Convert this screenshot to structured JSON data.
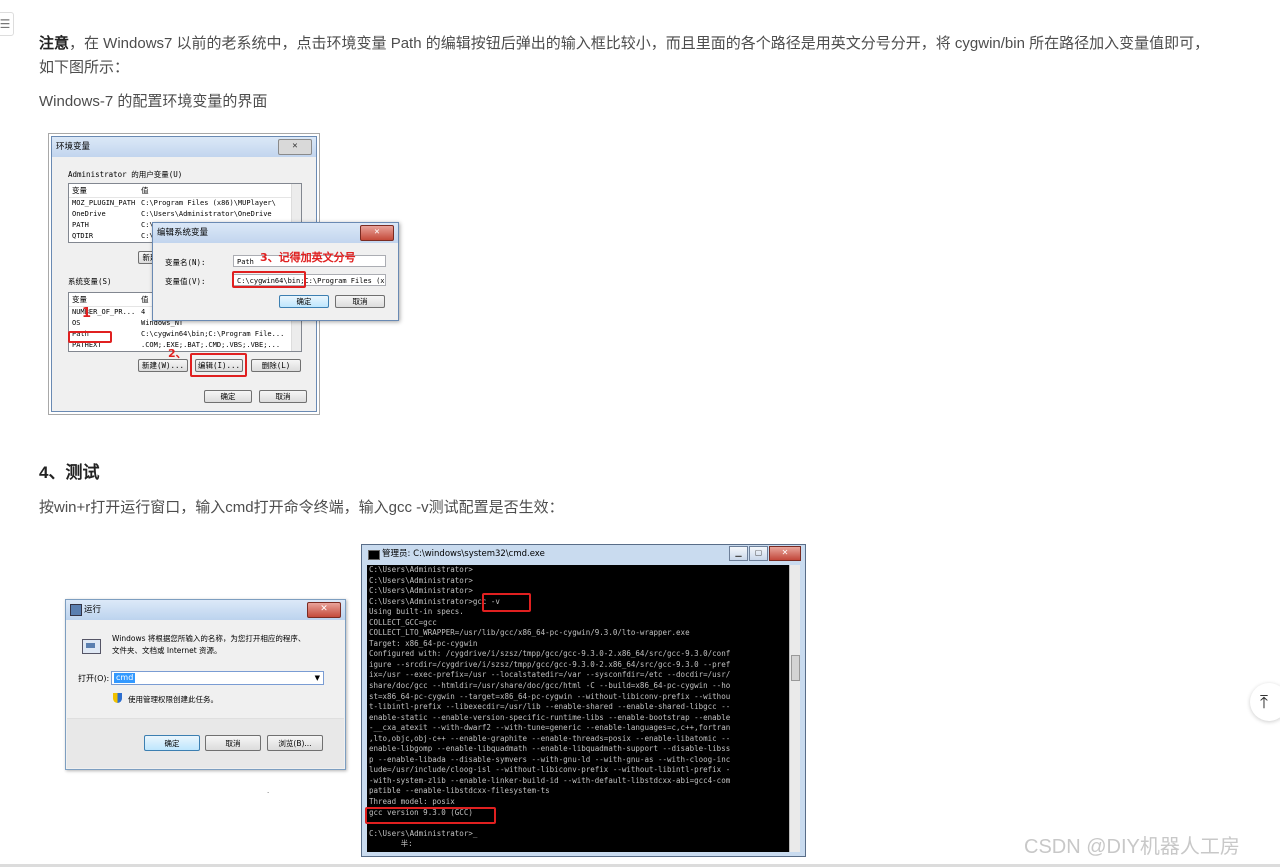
{
  "note": {
    "bold": "注意",
    "text_line1": "，在 Windows7 以前的老系统中，点击环境变量 Path 的编辑按钮后弹出的输入框比较小，而且里面的各个路径是用英文分号分开，将 cygwin/bin 所在路径加入变量值即可，",
    "text_line2": "如下图所示："
  },
  "caption1": "Windows-7 的配置环境变量的界面",
  "env_dialog": {
    "title": "环境变量",
    "user_group": "Administrator 的用户变量(U)",
    "col_var": "变量",
    "col_val": "值",
    "user_rows": [
      {
        "var": "MOZ_PLUGIN_PATH",
        "val": "C:\\Program Files (x86)\\MUPlayer\\"
      },
      {
        "var": "OneDrive",
        "val": "C:\\Users\\Administrator\\OneDrive"
      },
      {
        "var": "PATH",
        "val": "C:\\"
      },
      {
        "var": "QTDIR",
        "val": "C:\\"
      }
    ],
    "user_new_btn": "新建",
    "sys_group": "系统变量(S)",
    "sys_rows": [
      {
        "var": "NUMBER_OF_PR...",
        "val": "4"
      },
      {
        "var": "OS",
        "val": "Windows_NT"
      },
      {
        "var": "Path",
        "val": "C:\\cygwin64\\bin;C:\\Program File..."
      },
      {
        "var": "PATHEXT",
        "val": ".COM;.EXE;.BAT;.CMD;.VBS;.VBE;..."
      }
    ],
    "btn_new": "新建(W)...",
    "btn_edit": "编辑(I)...",
    "btn_delete": "删除(L)",
    "btn_ok": "确定",
    "btn_cancel": "取消",
    "mark1": "1",
    "mark2": "2、"
  },
  "edit_dialog": {
    "title": "编辑系统变量",
    "name_label": "变量名(N):",
    "name_value": "Path",
    "value_label": "变量值(V):",
    "value_value": "C:\\cygwin64\\bin;C:\\Program Files (x86",
    "btn_ok": "确定",
    "btn_cancel": "取消",
    "mark3": "3、记得加英文分号"
  },
  "section": {
    "title": "4、测试",
    "text": "按win+r打开运行窗口，输入cmd打开命令终端，输入gcc -v测试配置是否生效："
  },
  "run_dialog": {
    "title": "运行",
    "desc_line1": "Windows 将根据您所输入的名称，为您打开相应的程序、",
    "desc_line2": "文件夹、文档或 Internet 资源。",
    "open_label": "打开(O):",
    "input_value": "cmd",
    "admin_text": "使用管理权限创建此任务。",
    "btn_ok": "确定",
    "btn_cancel": "取消",
    "btn_browse": "浏览(B)..."
  },
  "cmd": {
    "title": "管理员: C:\\windows\\system32\\cmd.exe",
    "lines": [
      "C:\\Users\\Administrator>",
      "C:\\Users\\Administrator>",
      "C:\\Users\\Administrator>",
      "C:\\Users\\Administrator>gcc -v",
      "Using built-in specs.",
      "COLLECT_GCC=gcc",
      "COLLECT_LTO_WRAPPER=/usr/lib/gcc/x86_64-pc-cygwin/9.3.0/lto-wrapper.exe",
      "Target: x86_64-pc-cygwin",
      "Configured with: /cygdrive/i/szsz/tmpp/gcc/gcc-9.3.0-2.x86_64/src/gcc-9.3.0/conf",
      "igure --srcdir=/cygdrive/i/szsz/tmpp/gcc/gcc-9.3.0-2.x86_64/src/gcc-9.3.0 --pref",
      "ix=/usr --exec-prefix=/usr --localstatedir=/var --sysconfdir=/etc --docdir=/usr/",
      "share/doc/gcc --htmldir=/usr/share/doc/gcc/html -C --build=x86_64-pc-cygwin --ho",
      "st=x86_64-pc-cygwin --target=x86_64-pc-cygwin --without-libiconv-prefix --withou",
      "t-libintl-prefix --libexecdir=/usr/lib --enable-shared --enable-shared-libgcc --",
      "enable-static --enable-version-specific-runtime-libs --enable-bootstrap --enable",
      "-__cxa_atexit --with-dwarf2 --with-tune=generic --enable-languages=c,c++,fortran",
      ",lto,objc,obj-c++ --enable-graphite --enable-threads=posix --enable-libatomic --",
      "enable-libgomp --enable-libquadmath --enable-libquadmath-support --disable-libss",
      "p --enable-libada --disable-symvers --with-gnu-ld --with-gnu-as --with-cloog-inc",
      "lude=/usr/include/cloog-isl --without-libiconv-prefix --without-libintl-prefix -",
      "-with-system-zlib --enable-linker-build-id --with-default-libstdcxx-abi=gcc4-com",
      "patible --enable-libstdcxx-filesystem-ts",
      "Thread model: posix",
      "gcc version 9.3.0 (GCC)",
      "",
      "C:\\Users\\Administrator>_",
      "       半:"
    ]
  },
  "watermark": "CSDN @DIY机器人工房",
  "dot": "."
}
